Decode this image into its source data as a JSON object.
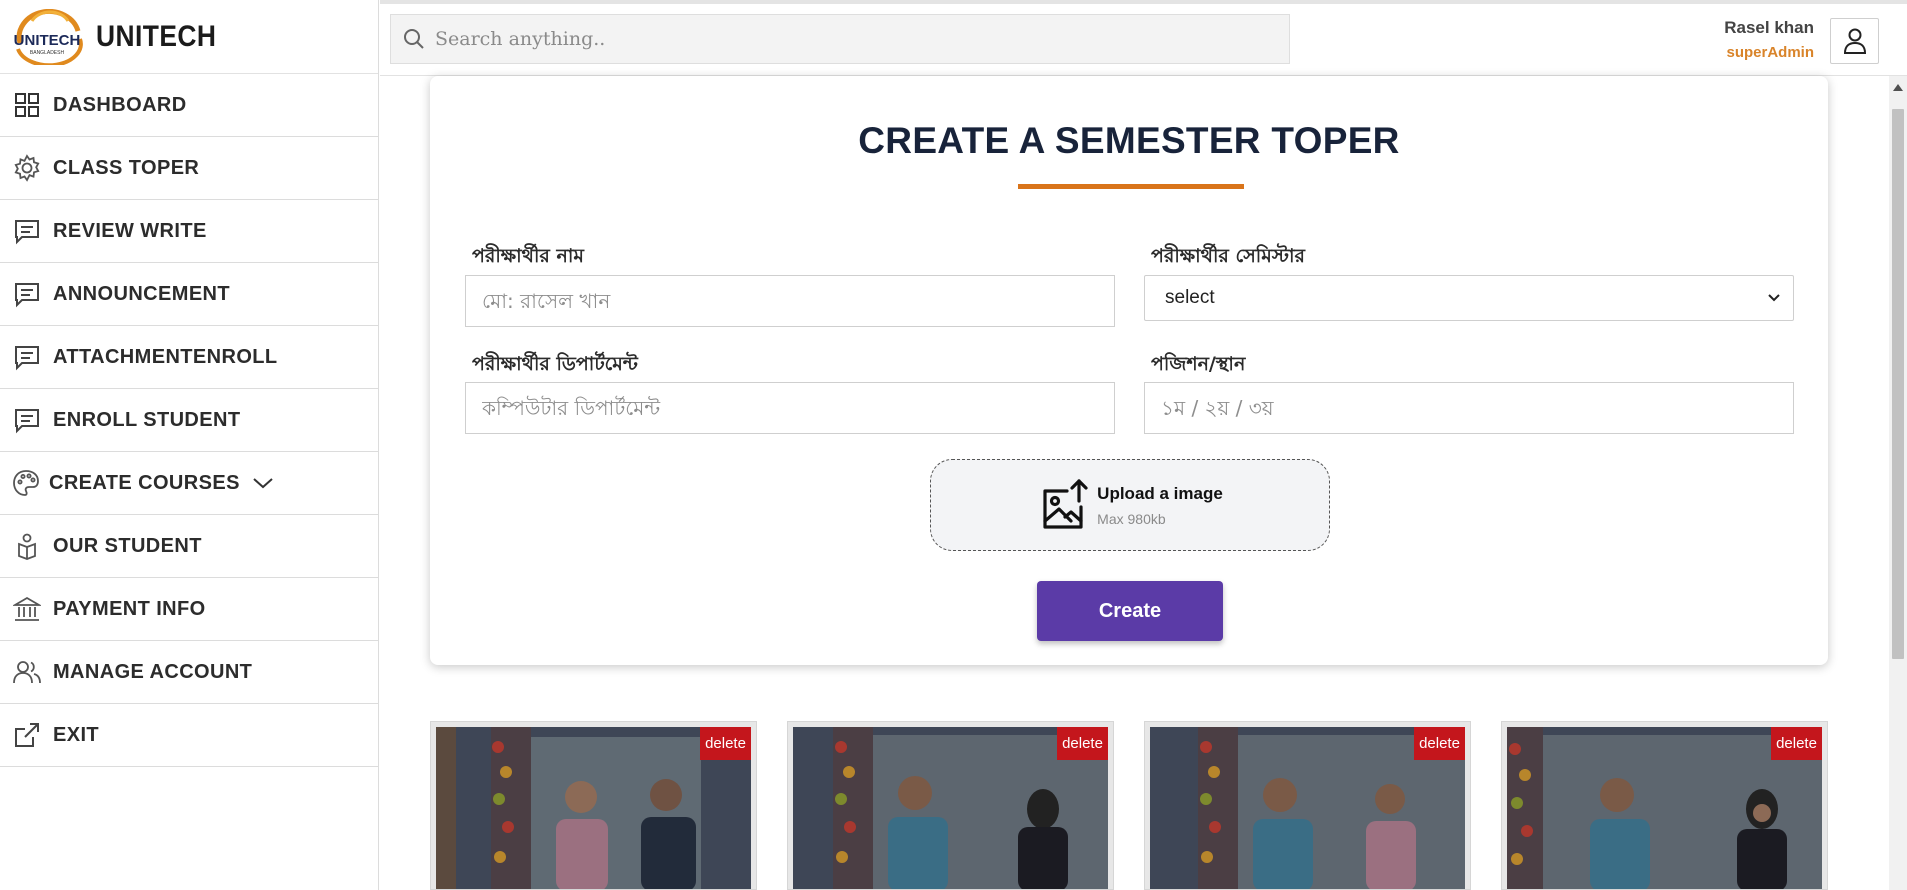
{
  "brand": {
    "name": "UNITECH",
    "logo_text": "UNITECH",
    "logo_subtext": "BANGLADESH"
  },
  "sidebar": {
    "items": [
      {
        "label": "DASHBOARD",
        "icon": "grid-icon"
      },
      {
        "label": "CLASS TOPER",
        "icon": "gear-icon"
      },
      {
        "label": "REVIEW WRITE",
        "icon": "message-icon"
      },
      {
        "label": "ANNOUNCEMENT",
        "icon": "message-icon"
      },
      {
        "label": "ATTACHMENTENROLL",
        "icon": "message-icon"
      },
      {
        "label": "ENROLL STUDENT",
        "icon": "message-icon"
      },
      {
        "label": "CREATE COURSES",
        "icon": "palette-icon"
      },
      {
        "label": "OUR STUDENT",
        "icon": "student-icon"
      },
      {
        "label": "PAYMENT INFO",
        "icon": "bank-icon"
      },
      {
        "label": "MANAGE ACCOUNT",
        "icon": "users-icon"
      },
      {
        "label": "EXIT",
        "icon": "external-link-icon"
      }
    ]
  },
  "header": {
    "search_placeholder": "Search anything..",
    "user_name": "Rasel khan",
    "user_role": "superAdmin"
  },
  "form": {
    "title": "CREATE A SEMESTER TOPER",
    "name_label": "পরীক্ষার্থীর নাম",
    "name_placeholder": "মো: রাসেল খান",
    "semester_label": "পরীক্ষার্থীর সেমিস্টার",
    "semester_selected": "select",
    "department_label": "পরীক্ষার্থীর ডিপার্টমেন্ট",
    "department_placeholder": "কম্পিউটার ডিপার্টমেন্ট",
    "position_label": "পজিশন/স্থান",
    "position_placeholder": "১ম / ২য় / ৩য়",
    "upload_title": "Upload a image",
    "upload_sub": "Max 980kb",
    "create_label": "Create"
  },
  "gallery": {
    "delete_label": "delete",
    "count": 4
  },
  "colors": {
    "accent_orange": "#d9741a",
    "primary_purple": "#5b3ba7",
    "delete_red": "#c4161c",
    "title_navy": "#18233a"
  }
}
